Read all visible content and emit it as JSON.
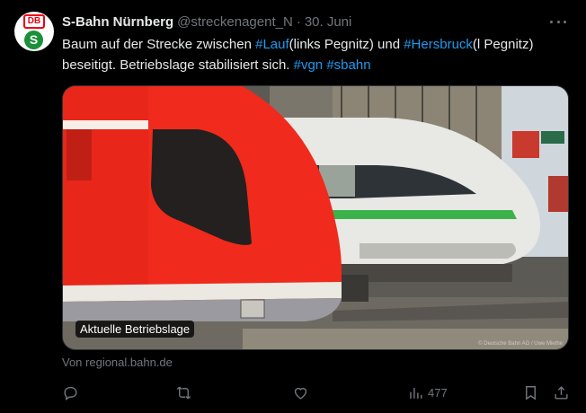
{
  "tweet": {
    "author_name": "S-Bahn Nürnberg",
    "handle": "@streckenagent_N",
    "separator": "·",
    "date": "30. Juni",
    "avatar": {
      "logo_text": "DB",
      "badge_text": "S",
      "brand_color": "#ec0016",
      "badge_color": "#1b8f3a"
    },
    "text_parts": {
      "t1": "Baum auf der Strecke zwischen ",
      "tag_lauf": "#Lauf",
      "t2": "(links Pegnitz) und ",
      "tag_hersbruck": "#Hersbruck",
      "t3": "(l Pegnitz) beseitigt. Betriebslage stabilisiert sich. ",
      "tag_vgn": "#vgn",
      "t4": " ",
      "tag_sbahn": "#sbahn"
    },
    "link_color": "#1d9bf0",
    "media": {
      "caption": "Aktuelle Betriebslage",
      "credit": "© Deutsche Bahn AG / Uwe Miethe"
    },
    "source": "Von regional.bahn.de",
    "actions": {
      "reply_icon": "reply-icon",
      "retweet_icon": "retweet-icon",
      "like_icon": "heart-icon",
      "views_icon": "views-icon",
      "views_count": "477",
      "bookmark_icon": "bookmark-icon",
      "share_icon": "share-icon"
    }
  }
}
